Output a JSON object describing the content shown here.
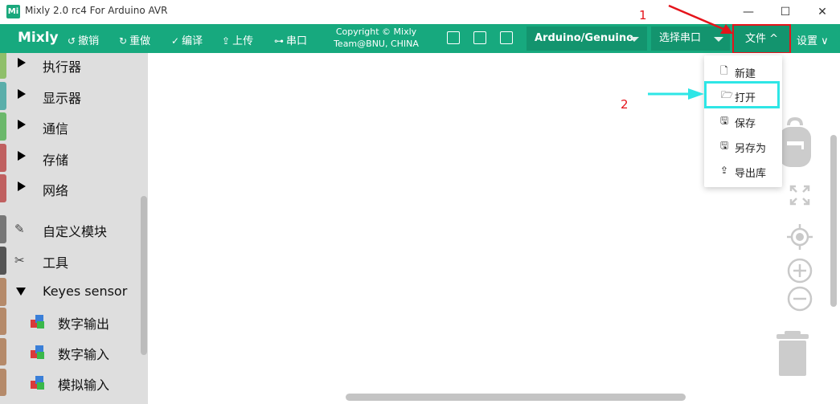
{
  "window": {
    "title": "Mixly 2.0 rc4 For Arduino AVR",
    "icon": "mixly-app-icon",
    "icon_text": "Mi",
    "controls": {
      "minimize": "—",
      "maximize": "☐",
      "close": "✕"
    }
  },
  "toolbar": {
    "brand": "Mixly",
    "undo": "撤销",
    "redo": "重做",
    "compile": "编译",
    "upload": "上传",
    "serial": "串口",
    "copyright_line1": "Copyright © Mixly",
    "copyright_line2": "Team@BNU, CHINA",
    "board": "Arduino/Genuino",
    "port": "选择串口",
    "file_menu": "文件",
    "settings": "设置",
    "accent_color": "#17a97e"
  },
  "sidebar": {
    "categories": [
      {
        "label": "执行器",
        "color": "#8fbf6a"
      },
      {
        "label": "显示器",
        "color": "#5aaeaa"
      },
      {
        "label": "通信",
        "color": "#6bb86b"
      },
      {
        "label": "存储",
        "color": "#c06060"
      },
      {
        "label": "网络",
        "color": "#c06060"
      },
      {
        "label": "自定义模块",
        "color": "#777777",
        "icon": "pen-icon"
      },
      {
        "label": "工具",
        "color": "#555555",
        "icon": "tools-icon"
      },
      {
        "label": "Keyes sensor",
        "color": "#b58a6a",
        "expanded": true
      }
    ],
    "subitems": [
      {
        "label": "数字输出"
      },
      {
        "label": "数字输入"
      },
      {
        "label": "模拟输入"
      }
    ]
  },
  "file_dropdown": {
    "items": [
      {
        "label": "新建",
        "icon": "new-file-icon"
      },
      {
        "label": "打开",
        "icon": "folder-open-icon",
        "highlighted": true
      },
      {
        "label": "保存",
        "icon": "save-icon"
      },
      {
        "label": "另存为",
        "icon": "save-as-icon"
      },
      {
        "label": "导出库",
        "icon": "export-icon"
      }
    ]
  },
  "annotations": {
    "step1": "1",
    "step2": "2",
    "arrow1_color": "#e5141b",
    "arrow2_color": "#2ee6e6"
  }
}
